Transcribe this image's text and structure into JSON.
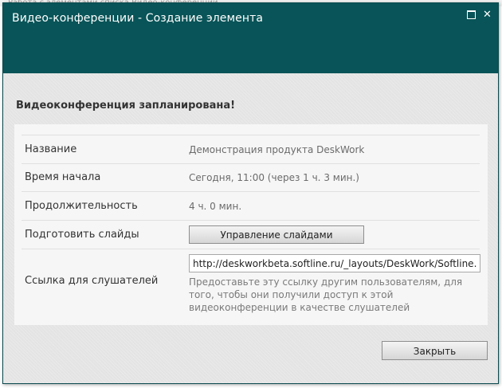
{
  "background_text": "Работа с элементами списка      Видео-конференции",
  "dialog": {
    "title": "Видео-конференции - Создание элемента",
    "heading": "Видеоконференция запланирована!",
    "fields": {
      "name": {
        "label": "Название",
        "value": "Демонстрация продукта DeskWork"
      },
      "start_time": {
        "label": "Время начала",
        "value": "Сегодня, 11:00 (через 1 ч. 3 мин.)"
      },
      "duration": {
        "label": "Продолжительность",
        "value": "4 ч. 0 мин."
      },
      "slides": {
        "label": "Подготовить слайды",
        "button_label": "Управление слайдами"
      },
      "listener_link": {
        "label": "Ссылка для слушателей",
        "value": "http://deskworkbeta.softline.ru/_layouts/DeskWork/Softline.Portal.Vi",
        "hint": "Предоставьте эту ссылку другим пользователям, для того, чтобы они получили доступ к этой видеоконференции в качестве слушателей"
      }
    },
    "close_button_label": "Закрыть"
  },
  "colors": {
    "titlebar": "#085458",
    "content_bg": "#e8e8e8"
  }
}
